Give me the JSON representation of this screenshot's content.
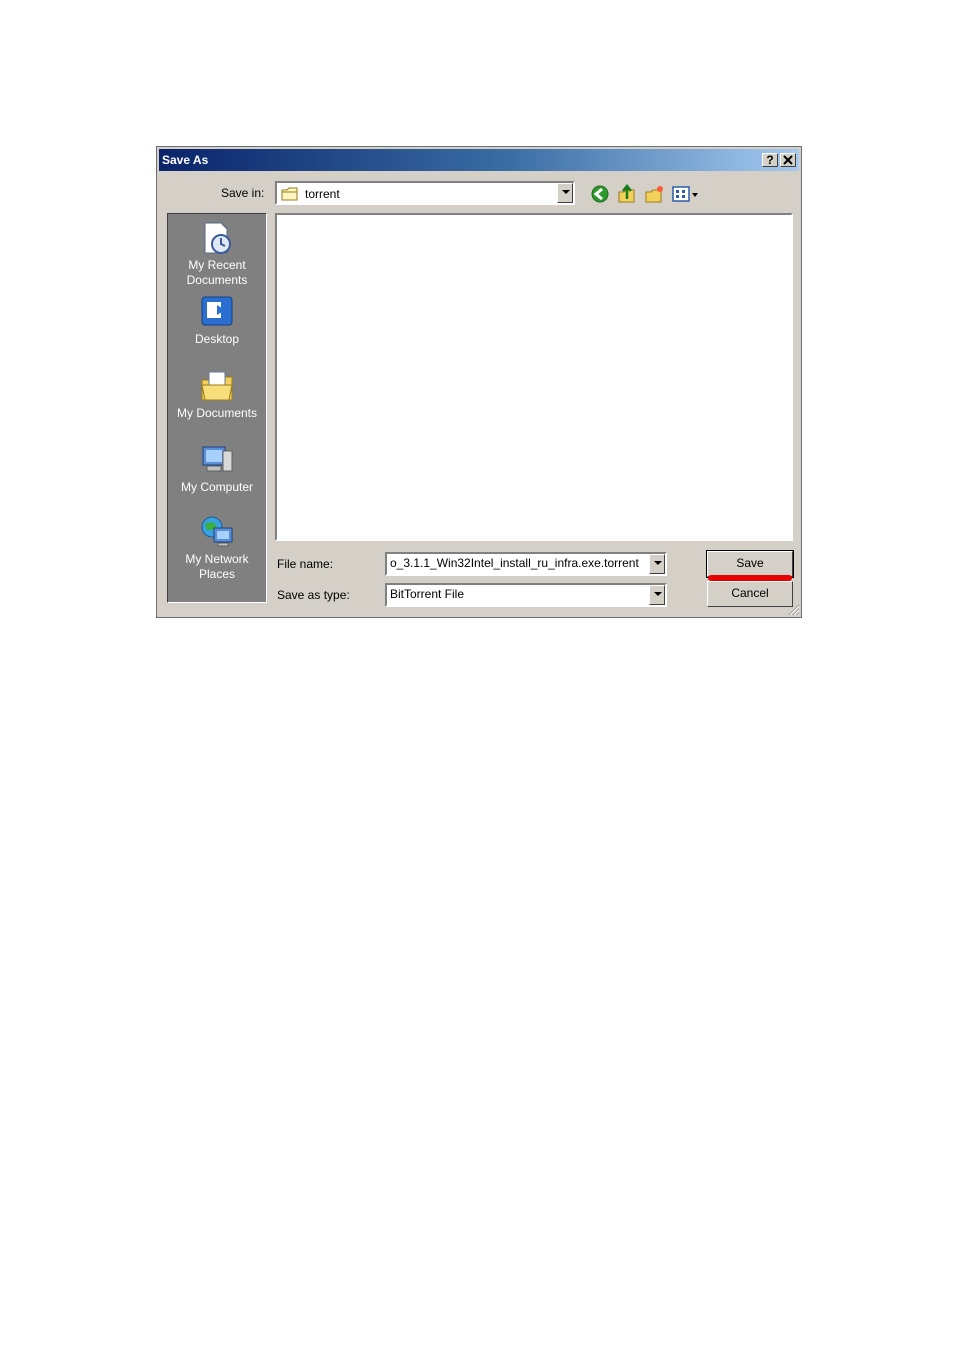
{
  "dialog": {
    "title": "Save As",
    "help_label": "?",
    "close_label": "✕"
  },
  "save_in": {
    "label": "Save in:",
    "value": "torrent"
  },
  "places": [
    {
      "label": "My Recent Documents",
      "icon": "recent-documents-icon"
    },
    {
      "label": "Desktop",
      "icon": "desktop-icon"
    },
    {
      "label": "My Documents",
      "icon": "my-documents-icon"
    },
    {
      "label": "My Computer",
      "icon": "my-computer-icon"
    },
    {
      "label": "My Network Places",
      "icon": "network-places-icon"
    }
  ],
  "file_name": {
    "label": "File name:",
    "value": "o_3.1.1_Win32Intel_install_ru_infra.exe.torrent"
  },
  "save_as_type": {
    "label": "Save as type:",
    "value": "BitTorrent File"
  },
  "buttons": {
    "save": "Save",
    "cancel": "Cancel"
  },
  "colors": {
    "titlebar_start": "#0a246a",
    "titlebar_end": "#a6caf0",
    "highlight_mark": "#e60000"
  }
}
